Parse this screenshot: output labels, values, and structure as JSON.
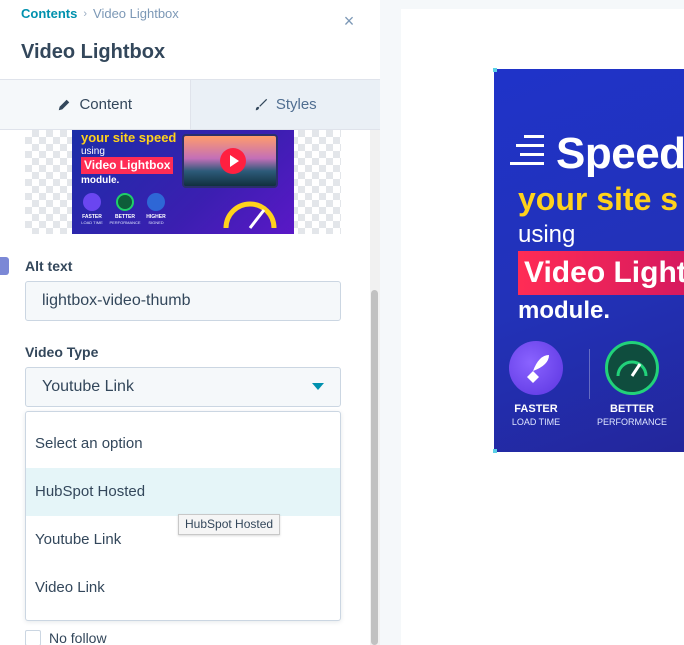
{
  "breadcrumb": {
    "parent": "Contents",
    "separator": "›",
    "current": "Video Lightbox"
  },
  "panel": {
    "title": "Video Lightbox",
    "close_icon": "×"
  },
  "tabs": [
    {
      "label": "Content",
      "icon": "pencil-icon",
      "active": true
    },
    {
      "label": "Styles",
      "icon": "brush-icon",
      "active": false
    }
  ],
  "thumbnail": {
    "line1": "your site speed",
    "line2": "using",
    "line3": "Video Lightbox",
    "line4": "module.",
    "feature1": "FASTER",
    "feature1_sub": "LOAD TIME",
    "feature2": "BETTER",
    "feature2_sub": "PERFORMANCE",
    "feature3": "HIGHER",
    "feature3_sub": "SIGNED"
  },
  "alt_text": {
    "label": "Alt text",
    "value": "lightbox-video-thumb"
  },
  "video_type": {
    "label": "Video Type",
    "selected": "Youtube Link",
    "options": [
      "Select an option",
      "HubSpot Hosted",
      "Youtube Link",
      "Video Link"
    ],
    "hovered_index": 1
  },
  "tooltip": "HubSpot Hosted",
  "no_follow": {
    "label": "No follow",
    "checked": false
  },
  "preview": {
    "speed": "Speed",
    "your_site": "your site s",
    "using": "using",
    "badge": "Video Light",
    "module": "module.",
    "f1_title": "FASTER",
    "f1_sub": "LOAD TIME",
    "f2_title": "BETTER",
    "f2_sub": "PERFORMANCE"
  },
  "colors": {
    "accent": "#0091ae",
    "text": "#33475b",
    "hero_blue": "#1f33c9",
    "hero_yellow": "#ffd21c",
    "badge_pink": "#ff2c55"
  }
}
